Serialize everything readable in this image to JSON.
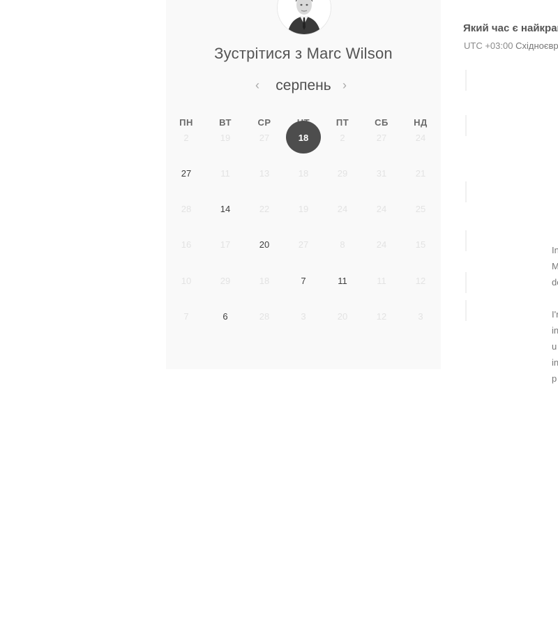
{
  "booking": {
    "title": "Зустрітися з Marc Wilson",
    "month": "серпень",
    "prev_icon": "‹",
    "next_icon": "›",
    "weekdays": [
      "ПН",
      "ВТ",
      "СР",
      "ЧТ",
      "ПТ",
      "СБ",
      "НД"
    ],
    "weeks": [
      [
        {
          "label": "2",
          "available": false
        },
        {
          "label": "19",
          "available": false
        },
        {
          "label": "27",
          "available": false
        },
        {
          "label": "18",
          "available": true,
          "selected": true
        },
        {
          "label": "2",
          "available": false
        },
        {
          "label": "27",
          "available": false
        },
        {
          "label": "24",
          "available": false
        }
      ],
      [
        {
          "label": "27",
          "available": true
        },
        {
          "label": "11",
          "available": false
        },
        {
          "label": "13",
          "available": false
        },
        {
          "label": "18",
          "available": false
        },
        {
          "label": "29",
          "available": false
        },
        {
          "label": "31",
          "available": false
        },
        {
          "label": "21",
          "available": false
        }
      ],
      [
        {
          "label": "28",
          "available": false
        },
        {
          "label": "14",
          "available": true
        },
        {
          "label": "22",
          "available": false
        },
        {
          "label": "19",
          "available": false
        },
        {
          "label": "24",
          "available": false
        },
        {
          "label": "24",
          "available": false
        },
        {
          "label": "25",
          "available": false
        }
      ],
      [
        {
          "label": "16",
          "available": false
        },
        {
          "label": "17",
          "available": false
        },
        {
          "label": "20",
          "available": true
        },
        {
          "label": "27",
          "available": false
        },
        {
          "label": "8",
          "available": false
        },
        {
          "label": "24",
          "available": false
        },
        {
          "label": "15",
          "available": false
        }
      ],
      [
        {
          "label": "10",
          "available": false
        },
        {
          "label": "29",
          "available": false
        },
        {
          "label": "18",
          "available": false
        },
        {
          "label": "7",
          "available": true
        },
        {
          "label": "11",
          "available": true
        },
        {
          "label": "11",
          "available": false
        },
        {
          "label": "12",
          "available": false
        }
      ],
      [
        {
          "label": "7",
          "available": false
        },
        {
          "label": "6",
          "available": true
        },
        {
          "label": "28",
          "available": false
        },
        {
          "label": "3",
          "available": false
        },
        {
          "label": "20",
          "available": false
        },
        {
          "label": "12",
          "available": false
        },
        {
          "label": "3",
          "available": false
        }
      ]
    ]
  },
  "sidebar": {
    "question": "Який час є найкращим",
    "timezone_offset": "UTC +03:00",
    "timezone_name": "Східноєвропейський час",
    "description_lines": [
      "In",
      "M",
      "de",
      "",
      "I'r",
      "in",
      "u",
      "in",
      "p"
    ]
  },
  "colors": {
    "selected_day_bg": "#4d4d4d",
    "available_day": "#3d3d3d",
    "unavailable_day": "#e3e3e3",
    "panel_bg": "#f9f9f9"
  }
}
